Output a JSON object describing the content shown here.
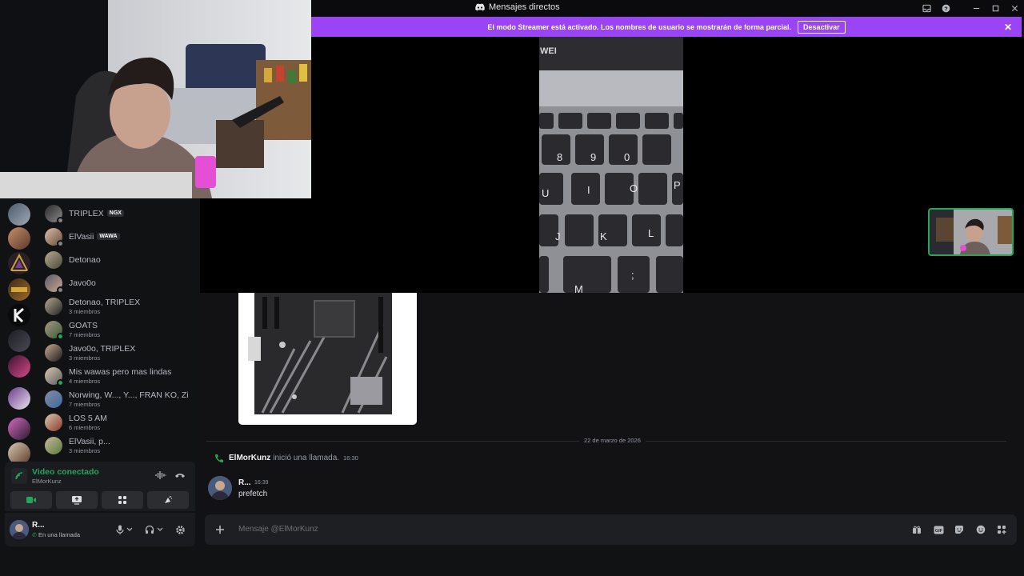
{
  "titlebar": {
    "title": "Mensajes directos"
  },
  "banner": {
    "text": "El modo Streamer está activado. Los nombres de usuario se mostrarán de forma parcial.",
    "button": "Desactivar"
  },
  "screenshare": {
    "brand_fragment": "WEI",
    "keys": [
      "8",
      "9",
      "0",
      "U",
      "I",
      "O",
      "P",
      "J",
      "K",
      "L",
      "M",
      ";"
    ]
  },
  "servers": [
    {
      "icon": "server-avatar"
    },
    {
      "icon": "server-avatar"
    },
    {
      "icon": "server-triangle"
    },
    {
      "icon": "server-avatar"
    },
    {
      "icon": "server-k-logo"
    },
    {
      "icon": "server-avatar"
    },
    {
      "icon": "server-avatar"
    },
    {
      "icon": "server-avatar"
    },
    {
      "icon": "server-avatar"
    },
    {
      "icon": "server-avatar"
    }
  ],
  "dms": [
    {
      "name": "TRIPLEX",
      "tag": "NGX",
      "sub": ""
    },
    {
      "name": "ElVasii",
      "tag": "WAWA",
      "sub": ""
    },
    {
      "name": "Detonao",
      "tag": "",
      "sub": ""
    },
    {
      "name": "Javo0o",
      "tag": "",
      "sub": ""
    },
    {
      "name": "Detonao, TRIPLEX",
      "tag": "",
      "sub": "3 miembros"
    },
    {
      "name": "GOATS",
      "tag": "",
      "sub": "7 miembros"
    },
    {
      "name": "Javo0o, TRIPLEX",
      "tag": "",
      "sub": "3 miembros"
    },
    {
      "name": "Mis wawas pero mas lindas",
      "tag": "",
      "sub": "4 miembros"
    },
    {
      "name": "Norwing, W..., Y..., FRAN KO, Zil...",
      "tag": "",
      "sub": "7 miembros"
    },
    {
      "name": "LOS 5 AM",
      "tag": "",
      "sub": "6 miembros"
    },
    {
      "name": "ElVasii, p...",
      "tag": "",
      "sub": "3 miembros"
    }
  ],
  "voice": {
    "status": "Video conectado",
    "channel": "ElMorKunz"
  },
  "user": {
    "name": "R...",
    "status": "En una llamada"
  },
  "chat": {
    "date_divider": "22 de marzo de 2026",
    "call": {
      "who": "ElMorKunz",
      "what": "inició una llamada.",
      "time": "16:30"
    },
    "message": {
      "author": "R...",
      "time": "16:39",
      "text": "prefetch"
    }
  },
  "composer": {
    "placeholder": "Mensaje @ElMorKunz"
  },
  "colors": {
    "accent_green": "#23a55a",
    "streamer_banner": "#9b44f5",
    "background": "#111214"
  }
}
